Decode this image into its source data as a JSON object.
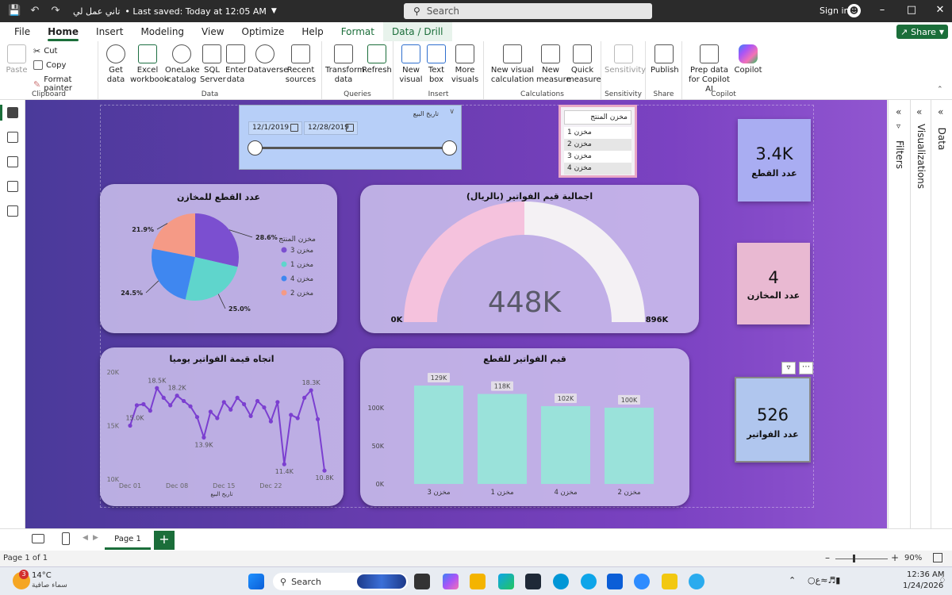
{
  "titlebar": {
    "title": "تاني عمل لي",
    "saved": "Last saved: Today at 12:05 AM",
    "search_placeholder": "Search",
    "signin": "Sign in"
  },
  "menu": {
    "tabs": [
      "File",
      "Home",
      "Insert",
      "Modeling",
      "View",
      "Optimize",
      "Help",
      "Format",
      "Data / Drill"
    ],
    "active": "Home",
    "share": "Share"
  },
  "ribbon": {
    "clipboard": {
      "paste": "Paste",
      "cut": "Cut",
      "copy": "Copy",
      "format_painter": "Format painter",
      "label": "Clipboard"
    },
    "data": {
      "get_data": "Get data",
      "excel": "Excel workbook",
      "onelake": "OneLake catalog",
      "sql": "SQL Server",
      "enter": "Enter data",
      "dataverse": "Dataverse",
      "recent": "Recent sources",
      "label": "Data"
    },
    "queries": {
      "transform": "Transform data",
      "refresh": "Refresh",
      "label": "Queries"
    },
    "insert": {
      "new_visual": "New visual",
      "text_box": "Text box",
      "more_visuals": "More visuals",
      "label": "Insert"
    },
    "calculations": {
      "new_visual_calc": "New visual calculation",
      "new_measure": "New measure",
      "quick_measure": "Quick measure",
      "label": "Calculations"
    },
    "sensitivity": {
      "sensitivity": "Sensitivity",
      "label": "Sensitivity"
    },
    "share": {
      "publish": "Publish",
      "label": "Share"
    },
    "copilot": {
      "prep": "Prep data for Copilot AI",
      "copilot": "Copilot",
      "label": "Copilot"
    }
  },
  "panes": {
    "filters": "Filters",
    "visualizations": "Visualizations",
    "data": "Data"
  },
  "date_slicer": {
    "label": "تاريخ البيع",
    "start": "12/1/2019",
    "end": "12/28/2019"
  },
  "wh_slicer": {
    "header": "مخزن المنتج",
    "items": [
      "مخزن 1",
      "مخزن 2",
      "مخزن 3",
      "مخزن 4"
    ]
  },
  "kpis": {
    "parts": {
      "value": "3.4K",
      "label": "عدد القطع"
    },
    "warehouses": {
      "value": "4",
      "label": "عدد المخازن"
    },
    "invoices": {
      "value": "526",
      "label": "عدد الفواتير"
    }
  },
  "pie_card": {
    "title": "عدد القطع للمخازن",
    "legend_title": "مخزن المنتج"
  },
  "gauge_card": {
    "title": "اجمالية قيم الفواتير (بالريال)",
    "value": "448K",
    "min": "0K",
    "max": "896K"
  },
  "line_card": {
    "title": "اتجاه قيمة الفواتير يوميا",
    "xlabel": "تاريخ البيع"
  },
  "bar_card": {
    "title": "قيم الفواتير للقطع"
  },
  "chart_data": [
    {
      "type": "pie",
      "title": "عدد القطع للمخازن",
      "legend_title": "مخزن المنتج",
      "slices": [
        {
          "name": "مخزن 3",
          "pct": 28.6,
          "label": "28.6%",
          "color": "#7b4fd0"
        },
        {
          "name": "مخزن 1",
          "pct": 25.0,
          "label": "25.0%",
          "color": "#5fd5cc"
        },
        {
          "name": "مخزن 4",
          "pct": 24.5,
          "label": "24.5%",
          "color": "#3f87f0"
        },
        {
          "name": "مخزن 2",
          "pct": 21.9,
          "label": "21.9%",
          "color": "#f59a86"
        }
      ]
    },
    {
      "type": "gauge",
      "value": 448,
      "min": 0,
      "max": 896,
      "unit": "K"
    },
    {
      "type": "line",
      "title": "اتجاه قيمة الفواتير يوميا",
      "xlabel": "تاريخ البيع",
      "x_ticks": [
        "Dec 01",
        "Dec 08",
        "Dec 15",
        "Dec 22"
      ],
      "y_ticks": [
        "10K",
        "15K",
        "20K"
      ],
      "ylim": [
        10,
        20
      ],
      "values": [
        15.0,
        16.9,
        17.0,
        16.4,
        18.5,
        17.6,
        16.9,
        17.8,
        17.3,
        16.8,
        15.8,
        13.9,
        16.3,
        15.7,
        17.2,
        16.5,
        17.6,
        17.0,
        15.9,
        17.3,
        16.7,
        15.4,
        17.2,
        11.4,
        16.0,
        15.7,
        17.6,
        18.3,
        15.6,
        10.8
      ],
      "labels": [
        {
          "idx": 0,
          "text": "15.0K"
        },
        {
          "idx": 4,
          "text": "18.5K"
        },
        {
          "idx": 7,
          "text": "18.2K"
        },
        {
          "idx": 11,
          "text": "13.9K"
        },
        {
          "idx": 23,
          "text": "11.4K"
        },
        {
          "idx": 27,
          "text": "18.3K"
        },
        {
          "idx": 29,
          "text": "10.8K"
        }
      ],
      "color": "#7b3fd0"
    },
    {
      "type": "bar",
      "title": "قيم الفواتير للقطع",
      "categories": [
        "مخزن 3",
        "مخزن 1",
        "مخزن 4",
        "مخزن 2"
      ],
      "values": [
        129,
        118,
        102,
        100
      ],
      "value_labels": [
        "129K",
        "118K",
        "102K",
        "100K"
      ],
      "y_ticks": [
        "0K",
        "50K",
        "100K"
      ],
      "ylim": [
        0,
        129
      ],
      "color": "#9ae2da"
    }
  ],
  "pagebar": {
    "page": "Page 1",
    "status": "Page 1 of 1",
    "zoom": "90%"
  },
  "taskbar": {
    "weather_temp": "14°C",
    "weather_desc": "سماء صافية",
    "search": "Search",
    "time": "12:36 AM",
    "date": "1/24/2026",
    "badge": "3"
  }
}
